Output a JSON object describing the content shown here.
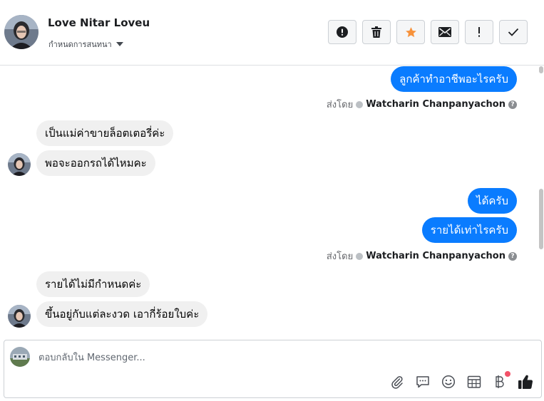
{
  "header": {
    "name": "Love Nitar Loveu",
    "assign_label": "กำหนดการสนทนา"
  },
  "actions": [
    {
      "icon": "alert-circle-icon",
      "name": "spam-button"
    },
    {
      "icon": "trash-icon",
      "name": "delete-button"
    },
    {
      "icon": "star-icon",
      "name": "star-button",
      "color": "#f7923b"
    },
    {
      "icon": "envelope-icon",
      "name": "mark-unread-button"
    },
    {
      "icon": "exclamation-icon",
      "name": "follow-up-button"
    },
    {
      "icon": "checkmark-icon",
      "name": "done-button"
    }
  ],
  "messages": [
    {
      "dir": "out",
      "text": "ลูกค้าทำอาชีพอะไรครับ"
    },
    {
      "dir": "meta",
      "prefix": "ส่งโดย",
      "agent": "Watcharin Chanpanyachon"
    },
    {
      "dir": "in",
      "text": "เป็นแม่ค่าขายล็อตเตอรี่ค่ะ"
    },
    {
      "dir": "in",
      "text": "พอจะออกรถได้ไหมคะ"
    },
    {
      "dir": "out",
      "text": "ได้ครับ"
    },
    {
      "dir": "out",
      "text": "รายได้เท่าไรครับ"
    },
    {
      "dir": "meta",
      "prefix": "ส่งโดย",
      "agent": "Watcharin Chanpanyachon"
    },
    {
      "dir": "in",
      "text": "รายได้ไม่มีกำหนดค่ะ"
    },
    {
      "dir": "in",
      "text": "ขึ้นอยู่กับแต่ละงวด เอากี่ร้อยใบค่ะ"
    }
  ],
  "composer": {
    "placeholder": "ตอบกลับใน Messenger...",
    "tools": [
      "paperclip-icon",
      "saved-reply-icon",
      "emoji-icon",
      "appointment-icon",
      "baht-icon",
      "like-icon"
    ]
  },
  "colors": {
    "outgoing": "#0a7cff",
    "incoming": "#f0f0f0",
    "notification": "#f25268"
  }
}
